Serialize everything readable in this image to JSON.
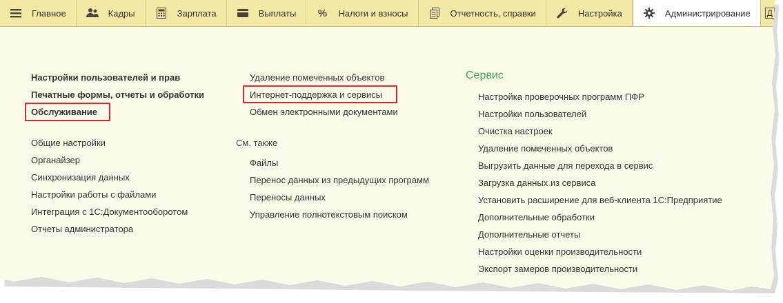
{
  "navbar": {
    "items": [
      {
        "label": "Главное",
        "icon": "menu-icon"
      },
      {
        "label": "Кадры",
        "icon": "people-icon"
      },
      {
        "label": "Зарплата",
        "icon": "calculator-icon"
      },
      {
        "label": "Выплаты",
        "icon": "wallet-icon"
      },
      {
        "label": "Налоги и взносы",
        "icon": "percent-icon"
      },
      {
        "label": "Отчетность, справки",
        "icon": "documents-icon"
      },
      {
        "label": "Настройка",
        "icon": "wrench-icon"
      },
      {
        "label": "Администрирование",
        "icon": "gear-icon",
        "active": true
      },
      {
        "label": "Д",
        "icon": ""
      }
    ],
    "percent_glyph": "%"
  },
  "left": {
    "bold_links": [
      "Настройки пользователей и прав",
      "Печатные формы, отчеты и обработки",
      "Обслуживание"
    ],
    "links": [
      "Общие настройки",
      "Органайзер",
      "Синхронизация данных",
      "Настройки работы с файлами",
      "Интеграция с 1С:Документооборотом",
      "Отчеты администратора"
    ]
  },
  "middle": {
    "links": [
      "Удаление помеченных объектов",
      "Интернет-поддержка и сервисы",
      "Обмен электронными документами"
    ],
    "see_also_label": "См. также",
    "see_also_links": [
      "Файлы",
      "Перенос данных из предыдущих программ",
      "Переносы данных",
      "Управление полнотекстовым поиском"
    ]
  },
  "right": {
    "heading": "Сервис",
    "links": [
      "Настройка проверочных программ ПФР",
      "Настройки пользователей",
      "Очистка настроек",
      "Удаление помеченных объектов",
      "Выгрузить данные для перехода в сервис",
      "Загрузка данных из сервиса",
      "Установить расширение для веб-клиента 1С:Предприятие",
      "Дополнительные обработки",
      "Дополнительные отчеты",
      "Настройки оценки производительности",
      "Экспорт замеров производительности"
    ]
  },
  "colors": {
    "navbar_bg": "#f4e9a4",
    "page_bg": "#fbfbe9",
    "heading_green": "#3aa05a",
    "highlight_red": "#e0232e"
  }
}
